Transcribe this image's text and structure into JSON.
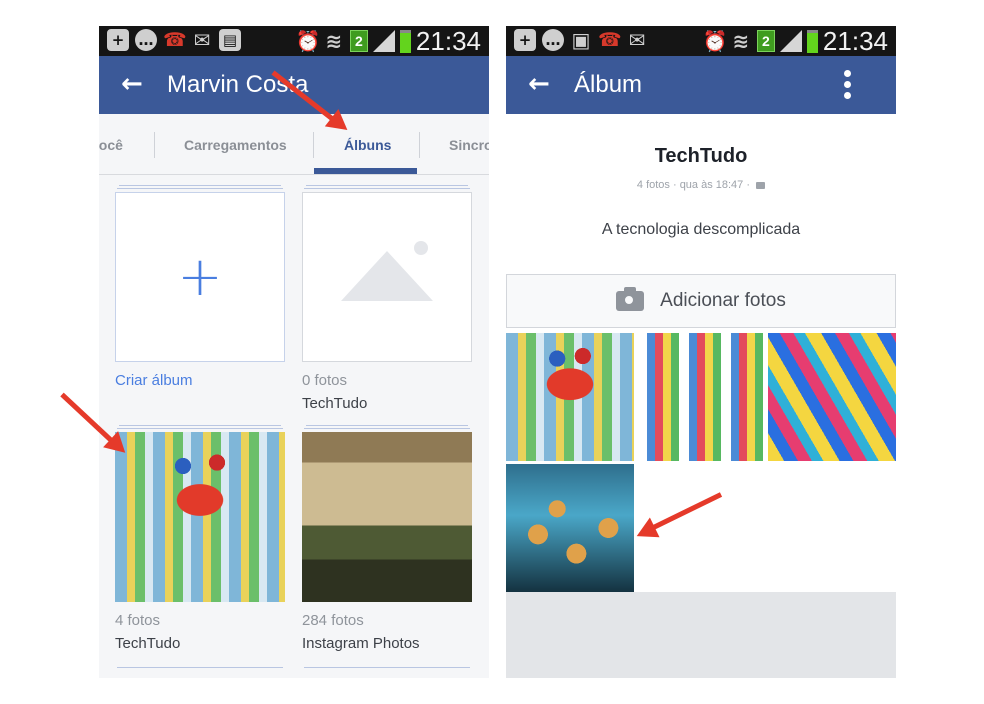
{
  "colors": {
    "brand": "#3b5998",
    "link": "#4a7ee0",
    "arrow": "#e53a2a",
    "status_bar": "#151515"
  },
  "status_bar": {
    "time": "21:34",
    "notification_count": "2",
    "left_screen_icons": [
      "add-icon",
      "chat-icon",
      "missed-call-icon",
      "mail-icon",
      "app-icon"
    ],
    "right_screen_icons": [
      "add-icon",
      "chat-icon",
      "image-icon",
      "missed-call-icon",
      "mail-icon"
    ]
  },
  "left_screen": {
    "title": "Marvin Costa",
    "tabs": [
      {
        "label": "você"
      },
      {
        "label": "Carregamentos"
      },
      {
        "label": "Álbuns",
        "active": true
      },
      {
        "label": "Sincro"
      }
    ],
    "albums": [
      {
        "link": "Criar álbum",
        "icon": "plus-icon"
      },
      {
        "count": "0 fotos",
        "name": "TechTudo",
        "icon": "image-placeholder-icon"
      },
      {
        "count": "4 fotos",
        "name": "TechTudo",
        "photo": "party-cake"
      },
      {
        "count": "284 fotos",
        "name": "Instagram Photos",
        "photo": "building-tree"
      }
    ]
  },
  "right_screen": {
    "title": "Álbum",
    "album": {
      "name": "TechTudo",
      "meta": "4 fotos · qua às 18:47 ·",
      "privacy_icon": "lock-icon",
      "description": "A tecnologia descomplicada"
    },
    "add_photos": {
      "label": "Adicionar fotos",
      "icon": "camera-icon"
    },
    "photos": [
      "party-cake",
      "party-favors",
      "party-bags",
      "popcorn"
    ]
  }
}
